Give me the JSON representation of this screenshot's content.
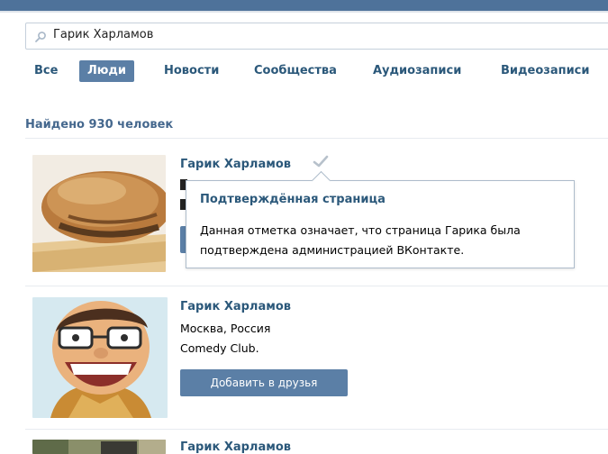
{
  "search": {
    "value": "Гарик Харламов"
  },
  "tabs": [
    {
      "label": "Все"
    },
    {
      "label": "Люди",
      "active": true
    },
    {
      "label": "Новости"
    },
    {
      "label": "Сообщества"
    },
    {
      "label": "Аудиозаписи"
    },
    {
      "label": "Видеозаписи"
    }
  ],
  "results": {
    "header": "Найдено 930 человек",
    "items": [
      {
        "name": "Гарик Харламов",
        "verified": true,
        "photo": "bread-icon"
      },
      {
        "name": "Гарик Харламов",
        "city": "Москва, Россия",
        "info": "Comedy Club.",
        "add_button": "Добавить в друзья",
        "photo": "caricature-icon"
      },
      {
        "name": "Гарик Харламов",
        "photo": "person-photo-icon"
      }
    ]
  },
  "tooltip": {
    "title": "Подтверждённая страница",
    "text": "Данная отметка означает, что страница Гарика была подтверждена администрацией ВКонтакте."
  },
  "colors": {
    "accent": "#5b7fa6",
    "link": "#2b587a",
    "header_bar": "#4e729a"
  }
}
